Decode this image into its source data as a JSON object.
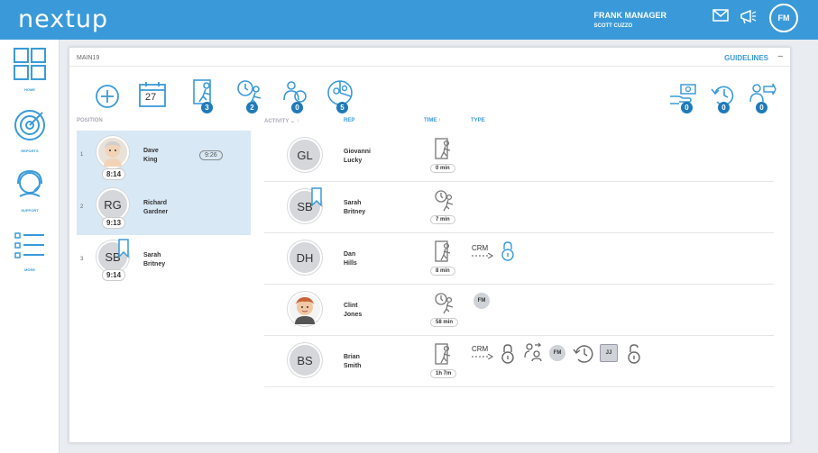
{
  "app": {
    "logo": "nextup"
  },
  "user": {
    "name": "FRANK MANAGER",
    "sub": "SCOTT CUZZO",
    "initials": "FM"
  },
  "topbar_icons": [
    "mail-icon",
    "announcement-icon"
  ],
  "sidebar": {
    "items": [
      {
        "label": "HOME",
        "icon": "home-grid-icon"
      },
      {
        "label": "REPORTS",
        "icon": "target-icon"
      },
      {
        "label": "SUPPORT",
        "icon": "headset-icon"
      },
      {
        "label": "MORE",
        "icon": "list-icon"
      }
    ]
  },
  "panel": {
    "title": "MAIN19",
    "guidelines": "GUIDELINES",
    "collapse": "–"
  },
  "toolbar": {
    "left": [
      {
        "icon": "add-icon"
      },
      {
        "icon": "calendar-icon",
        "text": "27"
      },
      {
        "icon": "walk-in-icon",
        "badge": "3"
      },
      {
        "icon": "appointment-icon",
        "badge": "2"
      },
      {
        "icon": "customer-icon",
        "badge": "0"
      },
      {
        "icon": "pie-person-icon",
        "badge": "5"
      }
    ],
    "right": [
      {
        "icon": "money-hand-icon",
        "badge": "0"
      },
      {
        "icon": "clock-rotate-icon",
        "badge": "0"
      },
      {
        "icon": "person-forward-icon",
        "badge": "0"
      }
    ]
  },
  "headers": {
    "position": "POSITION",
    "activity": "ACTIVITY",
    "rep": "REP",
    "time": "TIME",
    "type": "TYPE"
  },
  "positions": [
    {
      "num": "1",
      "first": "Dave",
      "last": "King",
      "time": "8:14",
      "wait": "9:26",
      "photo": true
    },
    {
      "num": "2",
      "first": "Richard",
      "last": "Gardner",
      "time": "9:13",
      "initials": "RG"
    },
    {
      "num": "3",
      "first": "Sarah",
      "last": "Britney",
      "time": "9:14",
      "initials": "SB",
      "bookmark": true
    }
  ],
  "activity": [
    {
      "initials": "GL",
      "first": "Giovanni",
      "last": "Lucky",
      "time": "0 min",
      "type": "walk-in"
    },
    {
      "initials": "SB",
      "first": "Sarah",
      "last": "Britney",
      "time": "7 min",
      "type": "appointment",
      "bookmark": true
    },
    {
      "initials": "DH",
      "first": "Dan",
      "last": "Hills",
      "time": "8 min",
      "type": "walk-in",
      "crm": "CRM"
    },
    {
      "initials": "",
      "first": "Clint",
      "last": "Jones",
      "time": "58 min",
      "type": "appointment",
      "photo": true,
      "chips": [
        "FM"
      ]
    },
    {
      "initials": "BS",
      "first": "Brian",
      "last": "Smith",
      "time": "1h 7m",
      "type": "walk-in",
      "crm": "CRM",
      "chips": [
        "FM",
        "JJ"
      ]
    }
  ],
  "colors": {
    "accent": "#3a9ad9",
    "badge": "#1f7ab8",
    "selected": "#d8e8f5"
  }
}
